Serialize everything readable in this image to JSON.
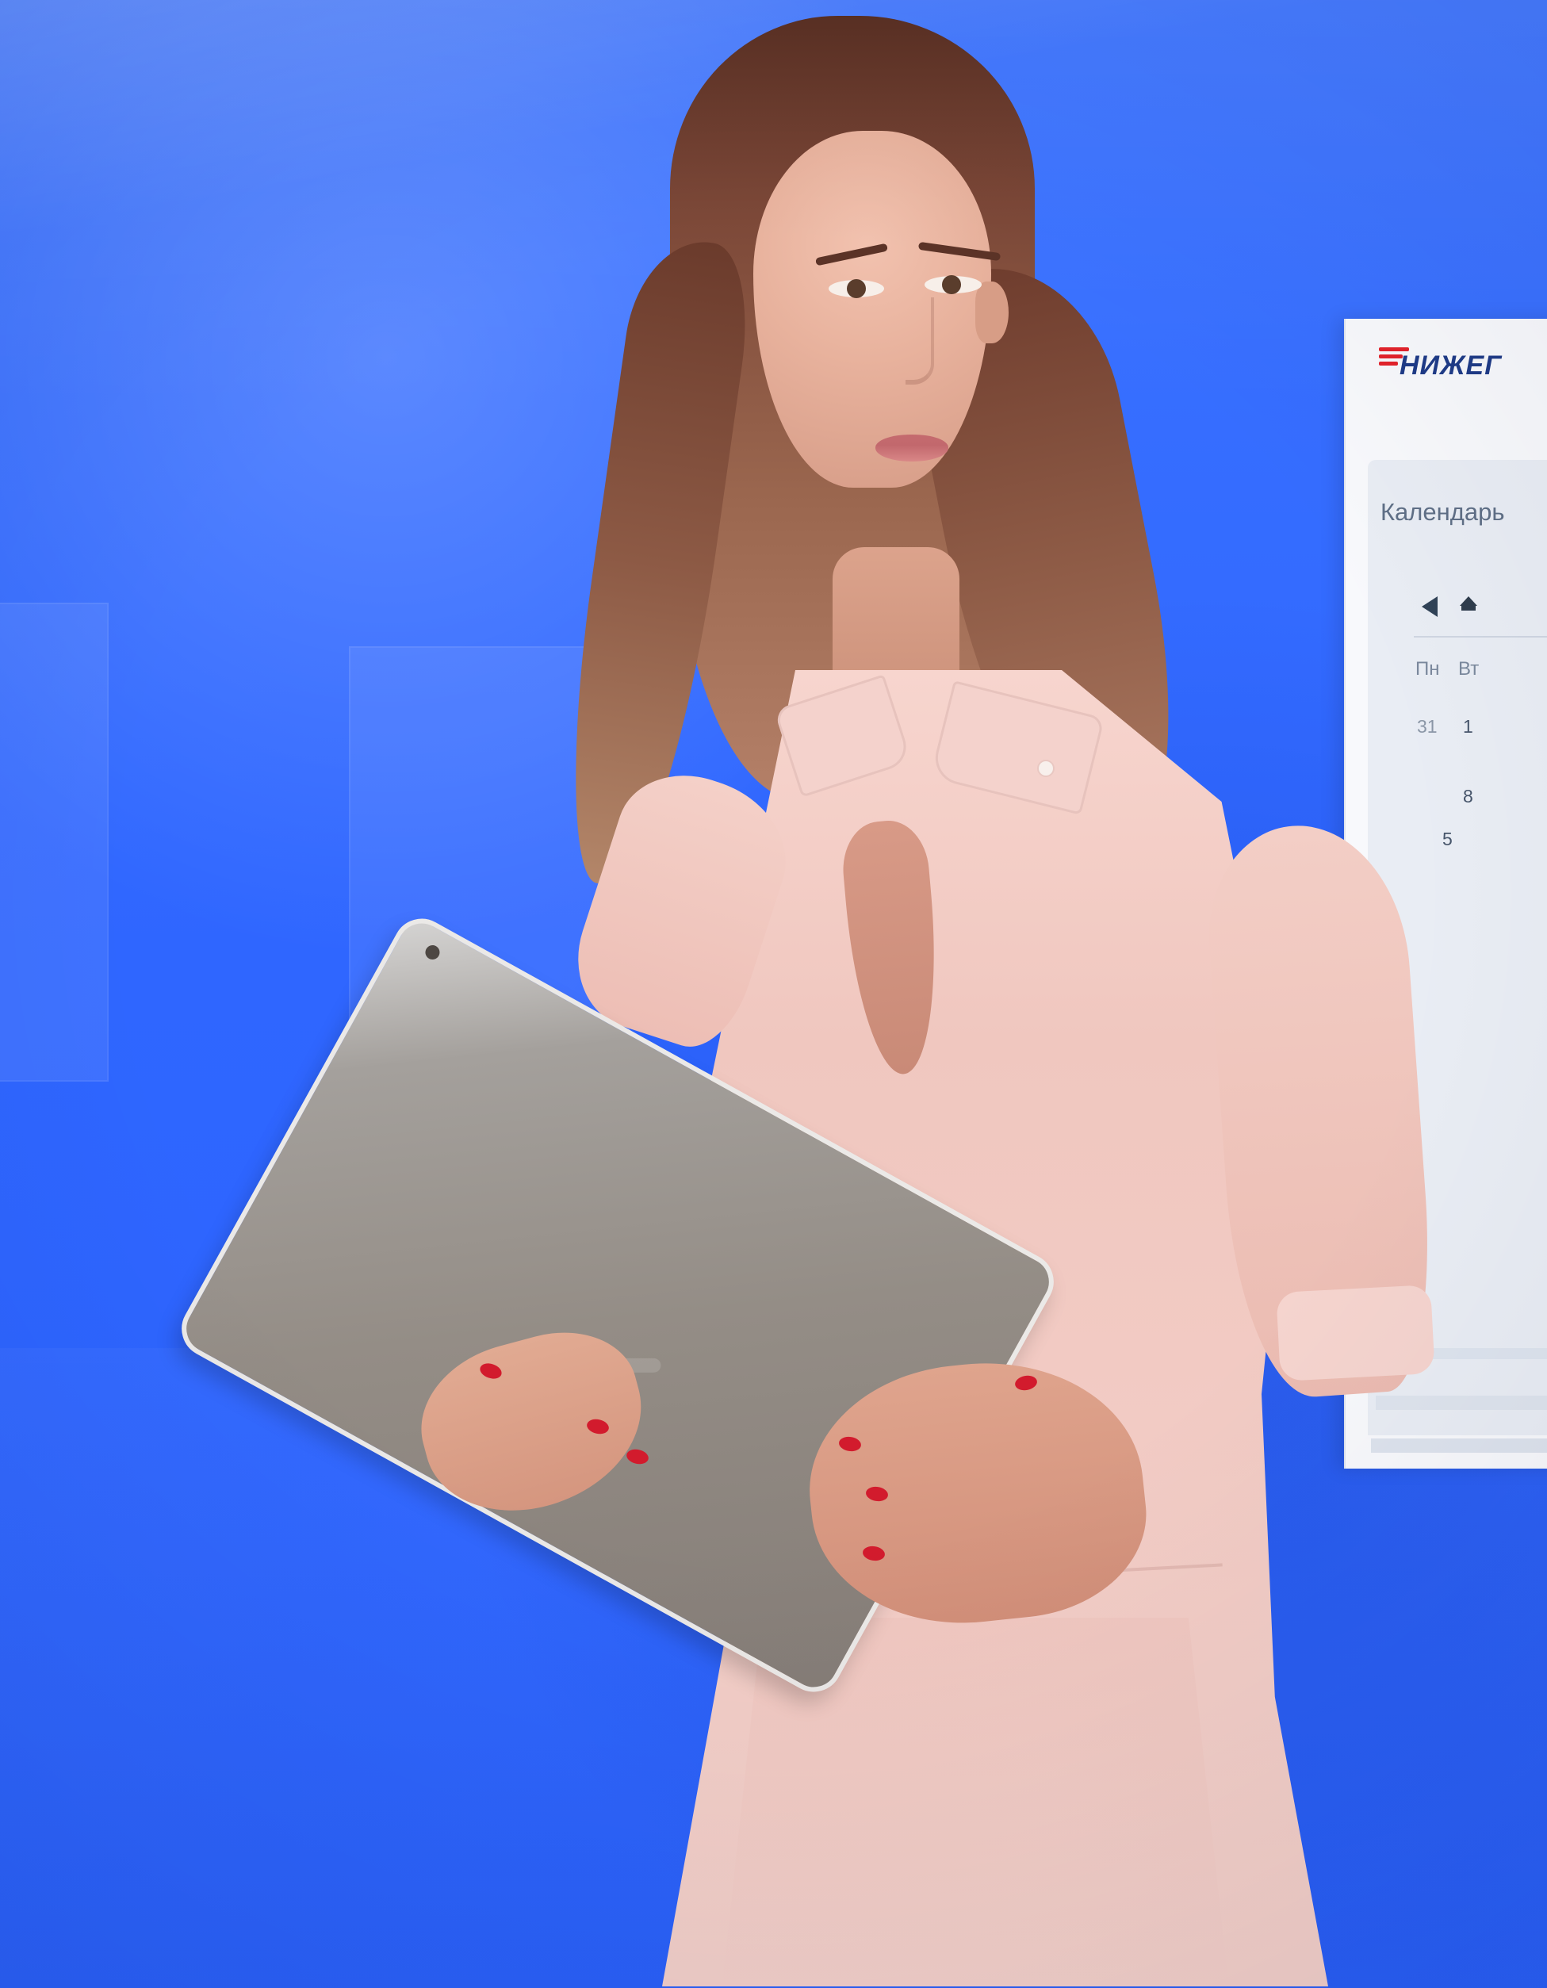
{
  "scene": {
    "background_color": "#2f66ff",
    "calendar_card": {
      "logo_text": "НИЖЕГ",
      "title": "Календарь",
      "weekdays": [
        "Пн",
        "Вт"
      ],
      "days": [
        "31",
        "1",
        "8",
        "5"
      ]
    },
    "person": {
      "dress_color": "#f2cbc4",
      "nail_color": "#d21b2d",
      "tablet_color": "#948d86"
    }
  }
}
